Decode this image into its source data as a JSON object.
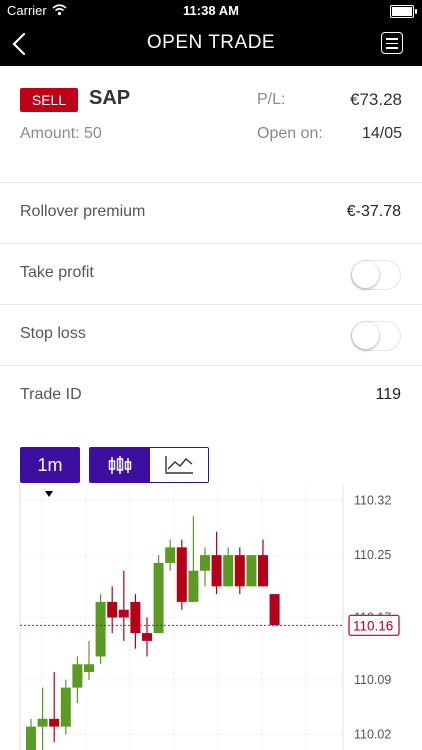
{
  "status": {
    "carrier": "Carrier",
    "time": "11:38 AM"
  },
  "nav": {
    "title": "OPEN TRADE"
  },
  "trade": {
    "direction": "SELL",
    "symbol": "SAP",
    "pl_label": "P/L:",
    "pl_value": "€73.28",
    "amount": "Amount: 50",
    "open_label": "Open on:",
    "open_value": "14/05"
  },
  "rows": {
    "rollover": {
      "label": "Rollover premium",
      "value": "€-37.78"
    },
    "take_profit": {
      "label": "Take profit",
      "enabled": false
    },
    "stop_loss": {
      "label": "Stop loss",
      "enabled": false
    },
    "trade_id": {
      "label": "Trade ID",
      "value": "119"
    }
  },
  "chart_controls": {
    "timeframe": "1m",
    "mode": "candlestick"
  },
  "colors": {
    "sell": "#c00016",
    "accent": "#3c0fa0",
    "up": "#5a9a25",
    "down": "#b5001a"
  },
  "chart_data": {
    "type": "candlestick",
    "y_ticks": [
      "110.32",
      "110.25",
      "110.17",
      "110.09",
      "110.02"
    ],
    "current_price": "110.16",
    "ylim": [
      110.0,
      110.34
    ],
    "candles": [
      {
        "o": 110.0,
        "c": 110.03,
        "h": 110.04,
        "l": 109.98
      },
      {
        "o": 110.03,
        "c": 110.04,
        "h": 110.08,
        "l": 110.0
      },
      {
        "o": 110.04,
        "c": 110.03,
        "h": 110.1,
        "l": 110.01
      },
      {
        "o": 110.03,
        "c": 110.08,
        "h": 110.09,
        "l": 110.02
      },
      {
        "o": 110.08,
        "c": 110.11,
        "h": 110.12,
        "l": 110.06
      },
      {
        "o": 110.1,
        "c": 110.11,
        "h": 110.14,
        "l": 110.09
      },
      {
        "o": 110.12,
        "c": 110.19,
        "h": 110.2,
        "l": 110.11
      },
      {
        "o": 110.19,
        "c": 110.17,
        "h": 110.21,
        "l": 110.15
      },
      {
        "o": 110.18,
        "c": 110.17,
        "h": 110.23,
        "l": 110.14
      },
      {
        "o": 110.19,
        "c": 110.15,
        "h": 110.2,
        "l": 110.13
      },
      {
        "o": 110.15,
        "c": 110.14,
        "h": 110.17,
        "l": 110.12
      },
      {
        "o": 110.15,
        "c": 110.24,
        "h": 110.25,
        "l": 110.15
      },
      {
        "o": 110.24,
        "c": 110.26,
        "h": 110.27,
        "l": 110.23
      },
      {
        "o": 110.26,
        "c": 110.19,
        "h": 110.27,
        "l": 110.18
      },
      {
        "o": 110.19,
        "c": 110.23,
        "h": 110.3,
        "l": 110.19
      },
      {
        "o": 110.23,
        "c": 110.25,
        "h": 110.26,
        "l": 110.21
      },
      {
        "o": 110.25,
        "c": 110.21,
        "h": 110.28,
        "l": 110.2
      },
      {
        "o": 110.21,
        "c": 110.25,
        "h": 110.26,
        "l": 110.21
      },
      {
        "o": 110.25,
        "c": 110.21,
        "h": 110.26,
        "l": 110.2
      },
      {
        "o": 110.21,
        "c": 110.25,
        "h": 110.25,
        "l": 110.21
      },
      {
        "o": 110.25,
        "c": 110.21,
        "h": 110.27,
        "l": 110.21
      },
      {
        "o": 110.2,
        "c": 110.16,
        "h": 110.2,
        "l": 110.16
      }
    ]
  }
}
